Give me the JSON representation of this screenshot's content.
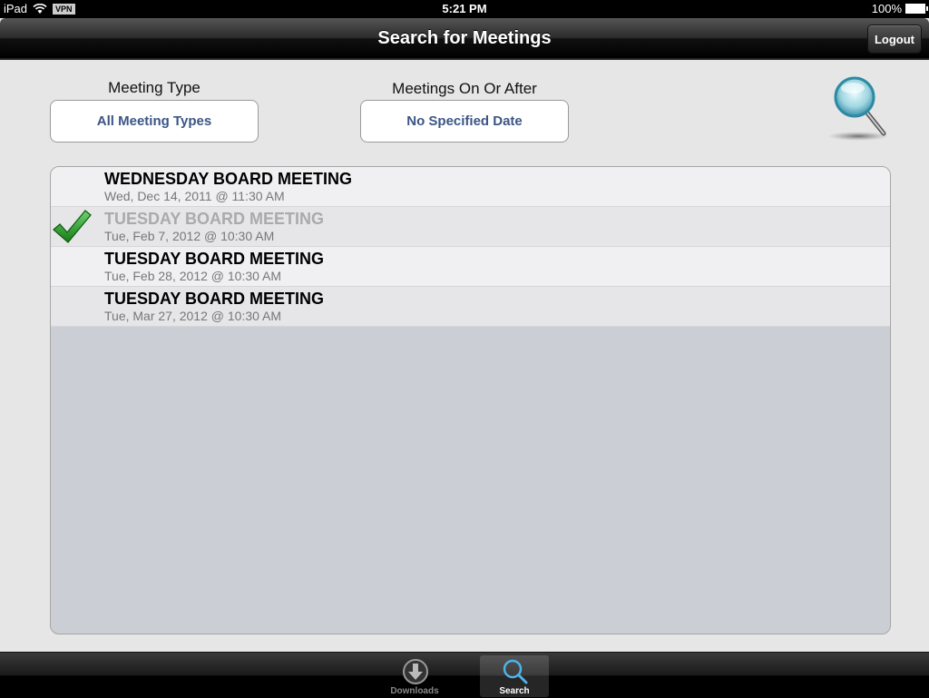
{
  "status_bar": {
    "device": "iPad",
    "vpn_label": "VPN",
    "time": "5:21 PM",
    "battery": "100%"
  },
  "nav_bar": {
    "title": "Search for Meetings",
    "logout_label": "Logout"
  },
  "filters": {
    "meeting_type_label": "Meeting Type",
    "meeting_type_value": "All Meeting Types",
    "date_label": "Meetings On Or After",
    "date_value": "No Specified Date"
  },
  "meetings": [
    {
      "title": "WEDNESDAY BOARD MEETING",
      "date": "Wed, Dec 14, 2011 @ 11:30 AM",
      "checked": false
    },
    {
      "title": "TUESDAY BOARD MEETING",
      "date": "Tue, Feb 7, 2012 @ 10:30 AM",
      "checked": true
    },
    {
      "title": "TUESDAY BOARD MEETING",
      "date": "Tue, Feb 28, 2012 @ 10:30 AM",
      "checked": false
    },
    {
      "title": "TUESDAY BOARD MEETING",
      "date": "Tue, Mar 27, 2012 @ 10:30 AM",
      "checked": false
    }
  ],
  "tab_bar": {
    "tabs": [
      {
        "label": "Downloads",
        "icon": "download-icon",
        "active": false
      },
      {
        "label": "Search",
        "icon": "search-icon",
        "active": true
      }
    ]
  },
  "colors": {
    "selector_text": "#3b5585",
    "check_green": "#2f9a2f",
    "active_tab_icon": "#4fb3e8"
  }
}
